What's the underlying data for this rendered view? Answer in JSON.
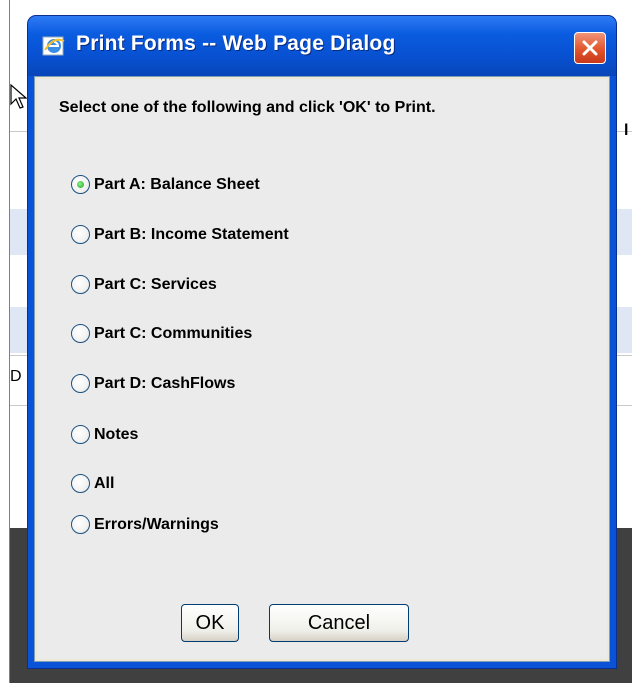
{
  "background": {
    "fragment_left": "D",
    "fragment_right": "l"
  },
  "dialog": {
    "title": "Print Forms -- Web Page Dialog",
    "instruction": "Select one of the following and click 'OK' to Print.",
    "options": [
      {
        "label": "Part A: Balance Sheet",
        "checked": true
      },
      {
        "label": "Part B: Income Statement",
        "checked": false
      },
      {
        "label": "Part C: Services",
        "checked": false
      },
      {
        "label": "Part C: Communities",
        "checked": false
      },
      {
        "label": "Part D: CashFlows",
        "checked": false
      },
      {
        "label": "Notes",
        "checked": false
      },
      {
        "label": "All",
        "checked": false
      },
      {
        "label": "Errors/Warnings",
        "checked": false
      }
    ],
    "ok_label": "OK",
    "cancel_label": "Cancel"
  },
  "colors": {
    "titlebar": "#0a53d6",
    "close_button": "#e2552c",
    "dialog_background": "#ebebeb",
    "selected_radio": "#21a121"
  }
}
